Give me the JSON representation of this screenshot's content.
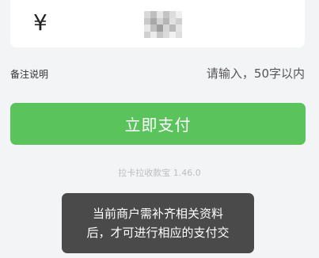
{
  "amount": {
    "currency_symbol": "¥",
    "mosaic_colors": [
      "#d9d9d9",
      "#bfbfbf",
      "#e6e6e6",
      "#c4c4c4",
      "#dcdcdc",
      "#efefef",
      "#c8c8c8",
      "#a8a8a8",
      "#d2d2d2",
      "#b5b5b5",
      "#e0e0e0",
      "#cfcfcf",
      "#e8e8e8",
      "#c0c0c0",
      "#9e9e9e",
      "#d6d6d6",
      "#b9b9b9",
      "#e4e4e4",
      "#d0d0d0",
      "#ebebeb",
      "#c6c6c6",
      "#dadada",
      "#f0f0f0",
      "#dedede"
    ]
  },
  "remark": {
    "label": "备注说明",
    "placeholder": "请输入，50字以内"
  },
  "pay_button": {
    "label": "立即支付",
    "color": "#5ac35c"
  },
  "footer": {
    "version": "拉卡拉收款宝 1.46.0"
  },
  "toast": {
    "line1": "当前商户需补齐相关资料",
    "line2": "后，才可进行相应的支付交"
  }
}
